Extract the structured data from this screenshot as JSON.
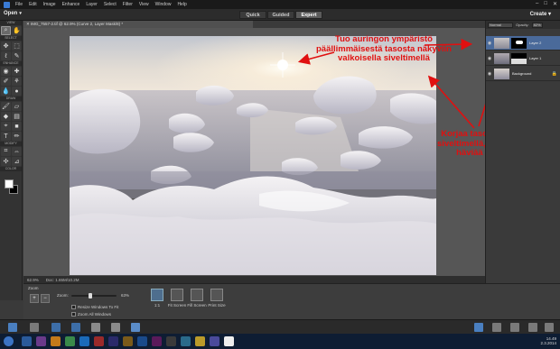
{
  "menubar": {
    "items": [
      "File",
      "Edit",
      "Image",
      "Enhance",
      "Layer",
      "Select",
      "Filter",
      "View",
      "Window",
      "Help"
    ],
    "window_controls": [
      "–",
      "□",
      "✕"
    ]
  },
  "modebar": {
    "open_label": "Open",
    "tabs": [
      "Quick",
      "Guided",
      "Expert"
    ],
    "active_tab": "Expert",
    "create_label": "Create"
  },
  "toolbox": {
    "sections": [
      "VIEW",
      "SELECT",
      "ENHANCE",
      "DRAW",
      "MODIFY",
      "COLOR"
    ]
  },
  "document": {
    "tab_title": "IMG_7557-2.tif @ 62.9% (Curve 2, Layer Mask/8) *"
  },
  "status": {
    "zoom": "62.9%",
    "doc_info": "Doc: 1.65M/10.2M"
  },
  "tool_options": {
    "title": "Zoom",
    "zoom_label": "Zoom:",
    "zoom_value": "63%",
    "zoom_fraction": 0.42,
    "resize_windows": "Resize Windows To Fit",
    "zoom_all": "Zoom All Windows",
    "view_buttons": [
      "1:1",
      "Fit Screen",
      "Fill Screen",
      "Print Size"
    ]
  },
  "layers": {
    "blend_mode": "Normal",
    "opacity_label": "Opacity:",
    "opacity": "82%",
    "rows": [
      {
        "name": "Layer 2"
      },
      {
        "name": "Layer 1"
      },
      {
        "name": "Background"
      }
    ]
  },
  "bottom_bar": {
    "left_items": [
      "Photo Bin",
      "Tool Options",
      "Undo",
      "Redo",
      "Rotate",
      "Layout",
      "Organizer"
    ],
    "right_items": [
      "Layers",
      "Effects",
      "Graphics",
      "Favorites",
      "More"
    ]
  },
  "annotations": {
    "top": "Tuo auringon ympäristö\npäällimmäisestä tasosta näkyviin\nvalkoisella siveltimellä",
    "right": "Korjaa tasomaskin rajaa\nsiveltimellä, siten että raja\nhäviää näkyvistä"
  },
  "taskbar": {
    "time": "14.49",
    "date": "2.3.2014"
  },
  "colors": {
    "annotation": "#e01010",
    "active_layer": "#4a6a9a",
    "app_bg": "#3a3a3a"
  }
}
